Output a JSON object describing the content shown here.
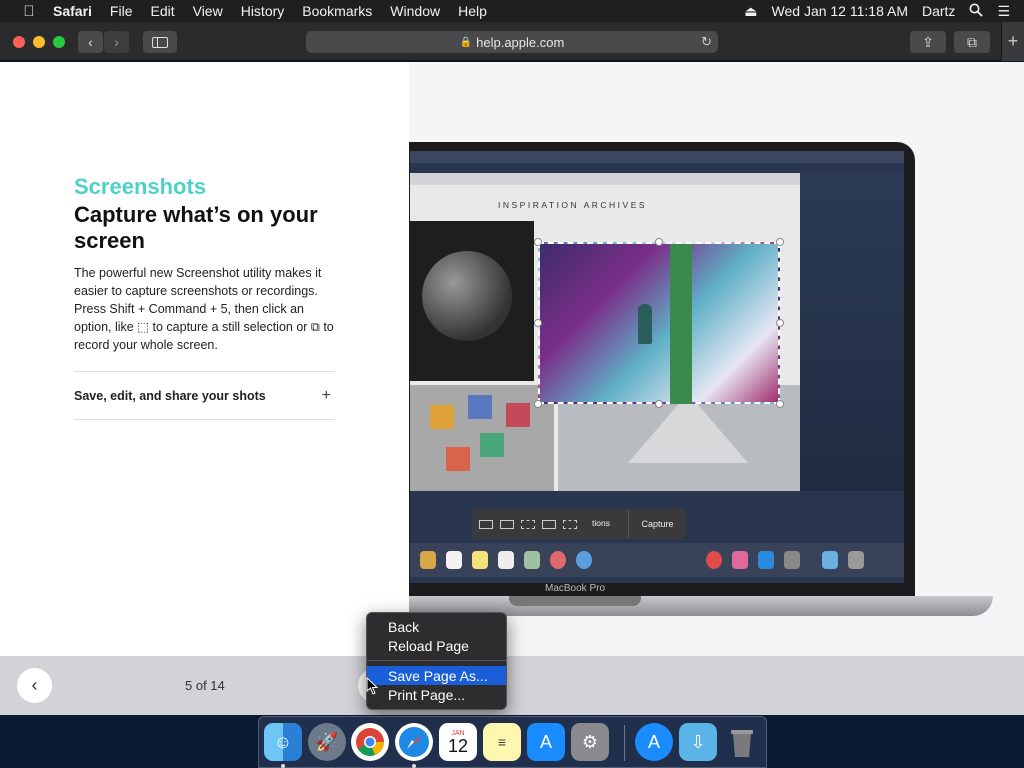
{
  "menubar": {
    "app": "Safari",
    "items": [
      "File",
      "Edit",
      "View",
      "History",
      "Bookmarks",
      "Window",
      "Help"
    ],
    "clock": "Wed Jan 12  11:18 AM",
    "user": "Dartz"
  },
  "toolbar": {
    "url": "help.apple.com"
  },
  "content": {
    "eyebrow": "Screenshots",
    "headline": "Capture what’s on your screen",
    "body": "The powerful new Screenshot utility makes it easier to capture screenshots or recordings. Press Shift + Command + 5, then click an option, like ⬚ to capture a still selection or ⧉ to record your whole screen.",
    "accordion": "Save, edit, and share your shots",
    "counter": "5 of 14"
  },
  "illustration": {
    "site_title": "INSPIRATION ARCHIVES",
    "options_label": "tions",
    "capture_label": "Capture",
    "device_label": "MacBook Pro"
  },
  "context_menu": {
    "items": [
      "Back",
      "Reload Page",
      "Save Page As...",
      "Print Page..."
    ],
    "highlighted": "Save Page As..."
  },
  "dock": {
    "calendar_month": "JAN",
    "calendar_day": "12"
  },
  "colors": {
    "accent": "#4fd1c9",
    "highlight": "#1a5fd8"
  }
}
